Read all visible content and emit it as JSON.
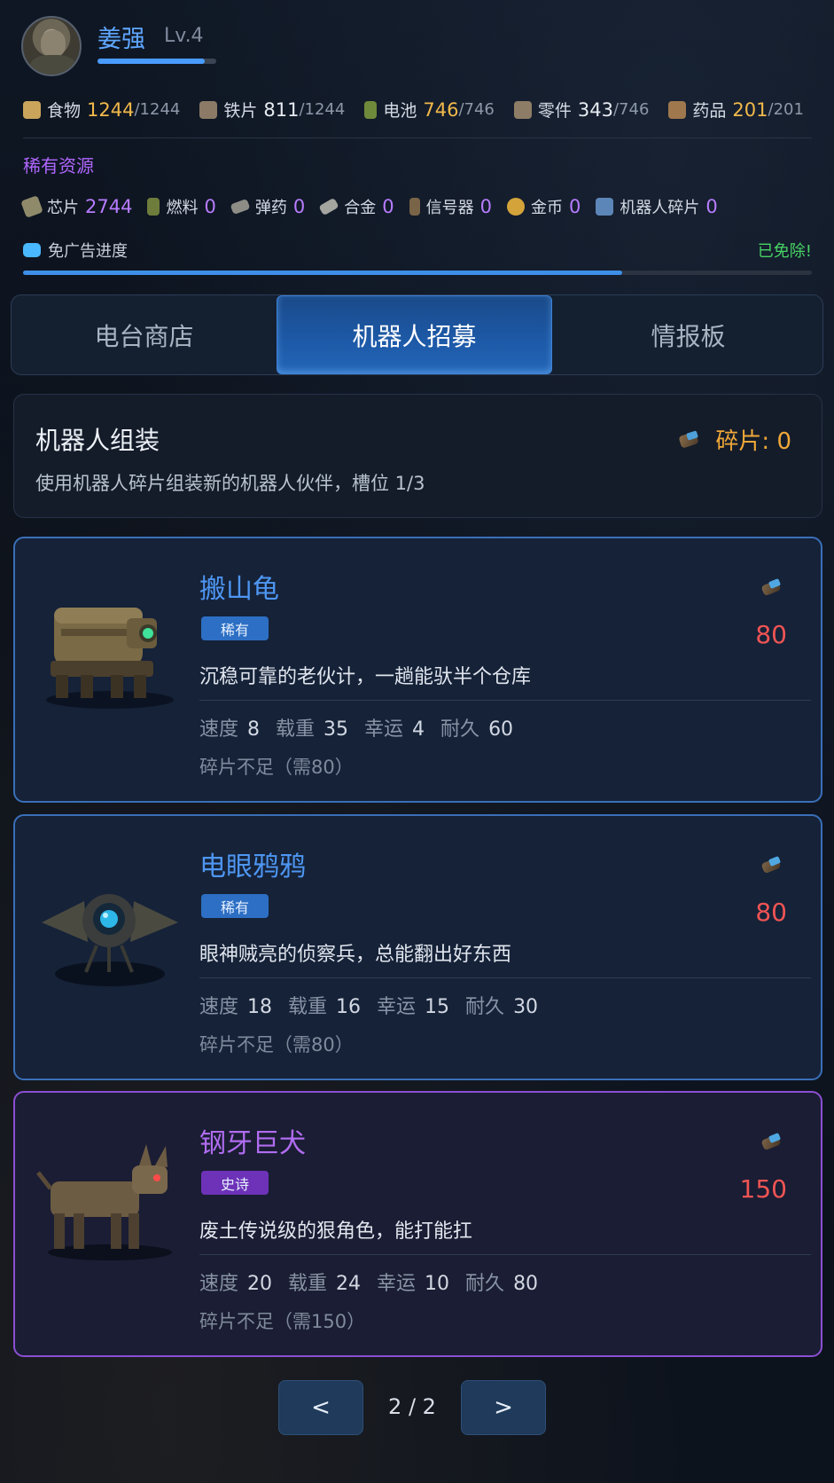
{
  "player": {
    "name": "姜强",
    "level": "Lv.4",
    "xp_fraction": 0.9
  },
  "resources": [
    {
      "icon": "food-can-icon",
      "label": "食物",
      "current": "1244",
      "max": "/1244",
      "color": "#c9a45a"
    },
    {
      "icon": "iron-sheet-icon",
      "label": "铁片",
      "current": "811",
      "max": "/1244",
      "color": "#8c7a66"
    },
    {
      "icon": "battery-icon",
      "label": "电池",
      "current": "746",
      "max": "/746",
      "color": "#6f8a3a"
    },
    {
      "icon": "parts-icon",
      "label": "零件",
      "current": "343",
      "max": "/746",
      "color": "#8e7d66"
    },
    {
      "icon": "medicine-icon",
      "label": "药品",
      "current": "201",
      "max": "/201",
      "color": "#a0784e"
    }
  ],
  "rare_title": "稀有资源",
  "rare_resources": [
    {
      "icon": "chip-icon",
      "label": "芯片",
      "value": "2744",
      "color": "#8f8a6a"
    },
    {
      "icon": "fuel-icon",
      "label": "燃料",
      "value": "0",
      "color": "#6e7d3c"
    },
    {
      "icon": "ammo-icon",
      "label": "弹药",
      "value": "0",
      "color": "#8d8d86"
    },
    {
      "icon": "alloy-icon",
      "label": "合金",
      "value": "0",
      "color": "#a5a5a0"
    },
    {
      "icon": "beacon-icon",
      "label": "信号器",
      "value": "0",
      "color": "#7a6448"
    },
    {
      "icon": "gold-coin-icon",
      "label": "金币",
      "value": "0",
      "color": "#d4a43a"
    },
    {
      "icon": "robot-fragment-icon",
      "label": "机器人碎片",
      "value": "0",
      "color": "#5d86b8"
    }
  ],
  "ad_progress": {
    "label": "免广告进度",
    "status": "已免除!",
    "fraction": 0.76
  },
  "tabs": [
    {
      "label": "电台商店",
      "active": false
    },
    {
      "label": "机器人招募",
      "active": true
    },
    {
      "label": "情报板",
      "active": false
    }
  ],
  "assembly": {
    "title": "机器人组装",
    "description": "使用机器人碎片组装新的机器人伙伴，槽位 1/3",
    "fragments_label": "碎片: 0"
  },
  "robots": [
    {
      "name": "搬山龟",
      "rarity": "稀有",
      "description": "沉稳可靠的老伙计，一趟能驮半个仓库",
      "stats": [
        {
          "k": "速度",
          "v": "8"
        },
        {
          "k": "载重",
          "v": "35"
        },
        {
          "k": "幸运",
          "v": "4"
        },
        {
          "k": "耐久",
          "v": "60"
        }
      ],
      "need": "碎片不足（需80）",
      "cost": "80"
    },
    {
      "name": "电眼鸦鸦",
      "rarity": "稀有",
      "description": "眼神贼亮的侦察兵，总能翻出好东西",
      "stats": [
        {
          "k": "速度",
          "v": "18"
        },
        {
          "k": "载重",
          "v": "16"
        },
        {
          "k": "幸运",
          "v": "15"
        },
        {
          "k": "耐久",
          "v": "30"
        }
      ],
      "need": "碎片不足（需80）",
      "cost": "80"
    },
    {
      "name": "钢牙巨犬",
      "rarity": "史诗",
      "description": "废土传说级的狠角色，能打能扛",
      "stats": [
        {
          "k": "速度",
          "v": "20"
        },
        {
          "k": "载重",
          "v": "24"
        },
        {
          "k": "幸运",
          "v": "10"
        },
        {
          "k": "耐久",
          "v": "80"
        }
      ],
      "need": "碎片不足（需150）",
      "cost": "150"
    }
  ],
  "pager": {
    "prev": "<",
    "text": "2 / 2",
    "next": ">"
  }
}
